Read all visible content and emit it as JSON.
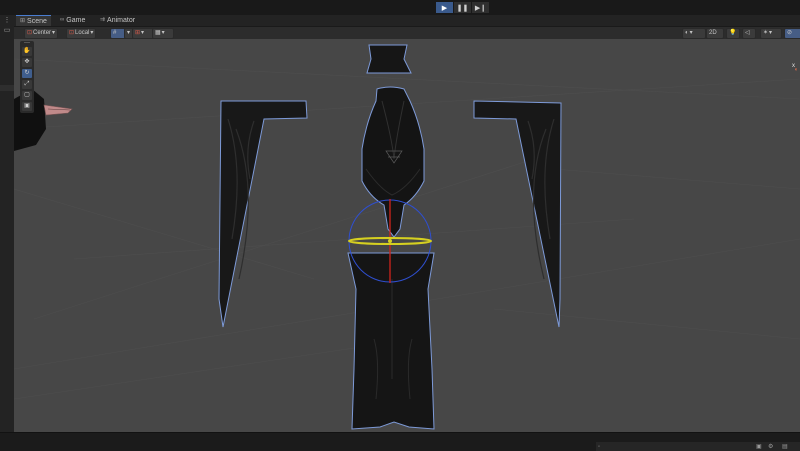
{
  "playback": {
    "play_icon": "play-icon",
    "pause_icon": "pause-icon",
    "step_icon": "step-icon"
  },
  "tabs": [
    {
      "label": "Scene",
      "icon": "scene-grid-icon"
    },
    {
      "label": "Game",
      "icon": "gamepad-icon"
    },
    {
      "label": "Animator",
      "icon": "animator-icon"
    }
  ],
  "toolbar": {
    "pivot_label": "Center",
    "space_label": "Local",
    "mode_2d_label": "2D"
  },
  "scene": {
    "tools": [
      "view-tool",
      "move-tool",
      "rotate-tool",
      "scale-tool",
      "rect-tool",
      "transform-tool"
    ],
    "active_tool": "rotate-tool",
    "axis_label": "x"
  },
  "colors": {
    "accent": "#3a5a8c",
    "gizmo_red": "#d0241c",
    "gizmo_blue": "#2f4fd0",
    "gizmo_yellow": "#d6d020",
    "scene_bg": "#474747",
    "garment": "#161616",
    "outline": "#7d9ad8"
  }
}
